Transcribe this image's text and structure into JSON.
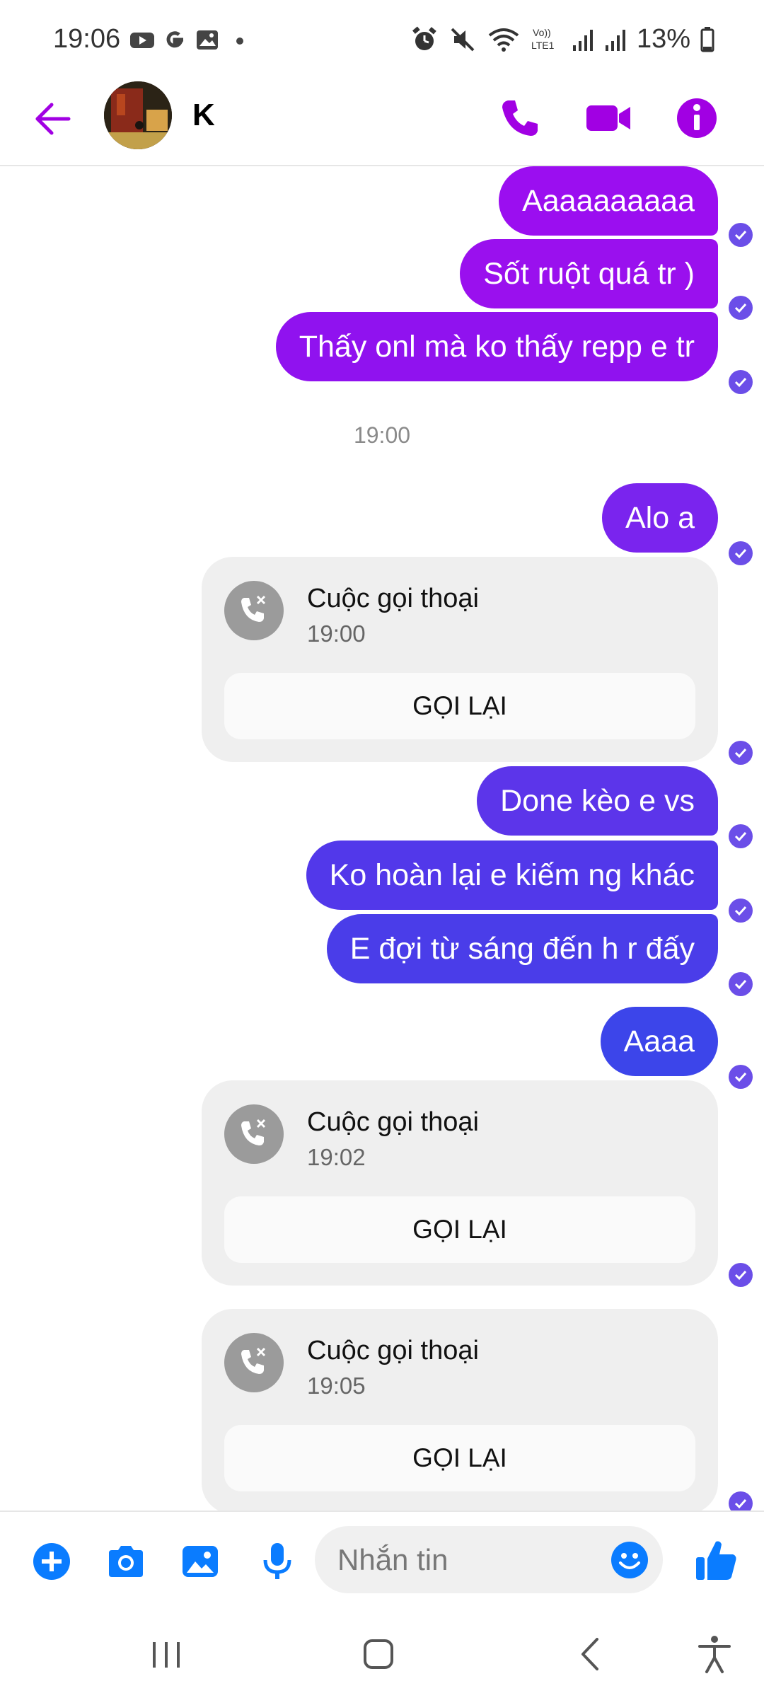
{
  "status_bar": {
    "time": "19:06",
    "battery": "13%",
    "network": "LTE1"
  },
  "header": {
    "contact_name": "K",
    "icons": [
      "back-arrow-icon",
      "phone-icon",
      "video-camera-icon",
      "info-icon"
    ],
    "accent_color": "#a100e3"
  },
  "messages": [
    {
      "type": "sent",
      "text": "Aaaaaaaaaa",
      "color": "#9b0ef0"
    },
    {
      "type": "sent",
      "text": "Sốt ruột quá tr )",
      "color": "#9a10ee"
    },
    {
      "type": "sent",
      "text": "Thấy onl mà ko thấy repp e tr",
      "color": "#9012ef"
    },
    {
      "type": "timestamp",
      "text": "19:00"
    },
    {
      "type": "sent",
      "text": "Alo a",
      "color": "#7a24ee"
    },
    {
      "type": "call",
      "title": "Cuộc gọi thoại",
      "time": "19:00",
      "button": "GỌI LẠI"
    },
    {
      "type": "sent",
      "text": "Done kèo e vs",
      "color": "#5c35ea"
    },
    {
      "type": "sent",
      "text": "Ko hoàn lại e kiếm ng khác",
      "color": "#5238ea"
    },
    {
      "type": "sent",
      "text": "E đợi từ sáng đến h r đấy",
      "color": "#4a3de9"
    },
    {
      "type": "sent",
      "text": "Aaaa",
      "color": "#3c45ea"
    },
    {
      "type": "call",
      "title": "Cuộc gọi thoại",
      "time": "19:02",
      "button": "GỌI LẠI"
    },
    {
      "type": "call",
      "title": "Cuộc gọi thoại",
      "time": "19:05",
      "button": "GỌI LẠI"
    }
  ],
  "composer": {
    "placeholder": "Nhắn tin",
    "icons": [
      "plus-icon",
      "camera-icon",
      "image-icon",
      "microphone-icon",
      "emoji-icon",
      "thumbs-up-icon"
    ],
    "icon_color": "#0a7cff"
  }
}
